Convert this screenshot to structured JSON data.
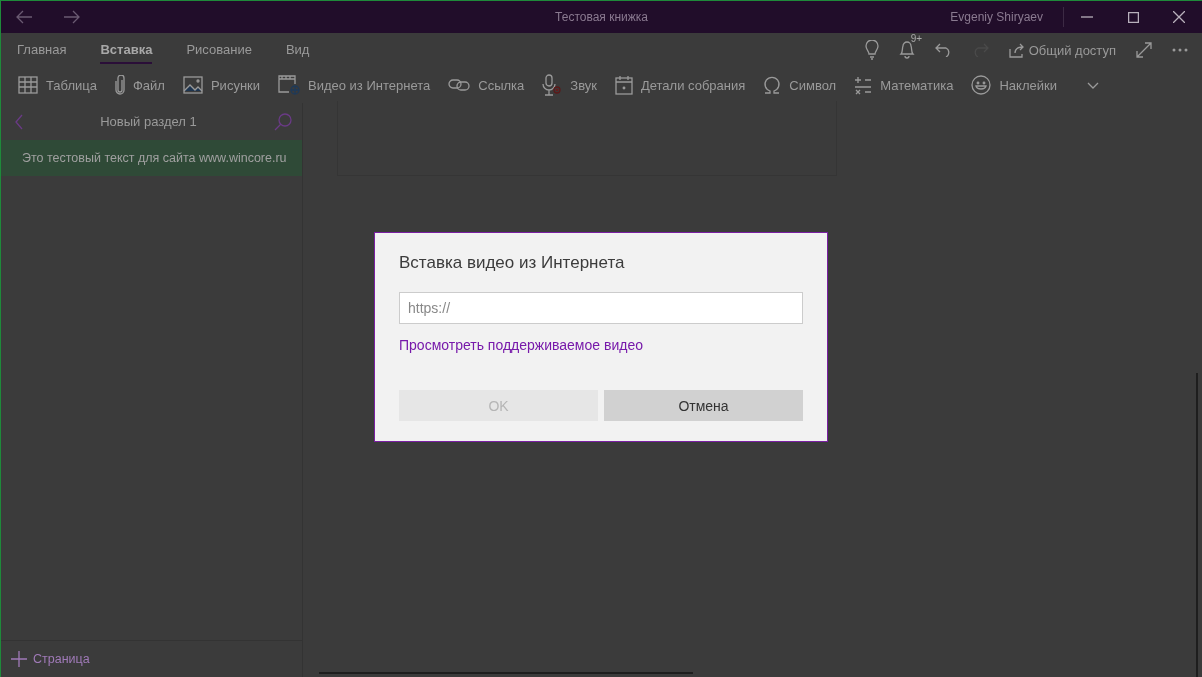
{
  "window": {
    "title": "Тестовая книжка",
    "user": "Evgeniy Shiryaev"
  },
  "tabs": [
    {
      "label": "Главная",
      "selected": false
    },
    {
      "label": "Вставка",
      "selected": true
    },
    {
      "label": "Рисование",
      "selected": false
    },
    {
      "label": "Вид",
      "selected": false
    }
  ],
  "actions": {
    "notification_badge": "9+",
    "redo_disabled": true,
    "share_label": "Общий доступ"
  },
  "toolbar": [
    {
      "label": "Таблица"
    },
    {
      "label": "Файл"
    },
    {
      "label": "Рисунки"
    },
    {
      "label": "Видео из Интернета"
    },
    {
      "label": "Ссылка"
    },
    {
      "label": "Звук"
    },
    {
      "label": "Детали собрания"
    },
    {
      "label": "Символ"
    },
    {
      "label": "Математика"
    },
    {
      "label": "Наклейки"
    }
  ],
  "sidebar": {
    "section_title": "Новый раздел 1",
    "pages": [
      {
        "title": "Это тестовый текст для сайта www.wincore.ru",
        "selected": true
      }
    ],
    "add_page_label": "Страница"
  },
  "dialog": {
    "title": "Вставка видео из Интернета",
    "url_field": {
      "placeholder": "https://"
    },
    "link": "Просмотреть поддерживаемое видео",
    "buttons": [
      {
        "label": "OK",
        "disabled": true
      },
      {
        "label": "Отмена",
        "disabled": false
      }
    ]
  }
}
